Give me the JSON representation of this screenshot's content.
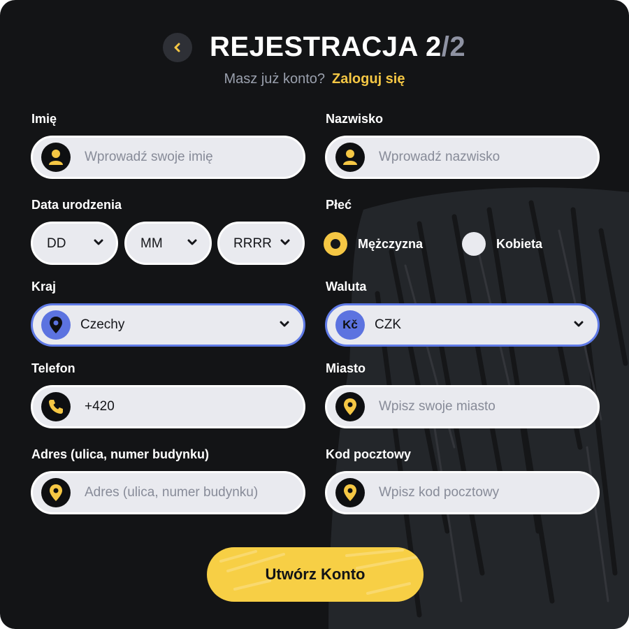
{
  "header": {
    "title_main": "REJESTRACJA 2",
    "title_sep": "/",
    "title_total": "2",
    "subtitle_text": "Masz już konto?",
    "login_link": "Zaloguj się"
  },
  "form": {
    "first_name": {
      "label": "Imię",
      "placeholder": "Wprowadź swoje imię"
    },
    "last_name": {
      "label": "Nazwisko",
      "placeholder": "Wprowadź nazwisko"
    },
    "birth_date": {
      "label": "Data urodzenia",
      "day": "DD",
      "month": "MM",
      "year": "RRRR"
    },
    "gender": {
      "label": "Płeć",
      "options": [
        "Mężczyzna",
        "Kobieta"
      ],
      "selected": "Mężczyzna"
    },
    "country": {
      "label": "Kraj",
      "value": "Czechy"
    },
    "currency": {
      "label": "Waluta",
      "value": "CZK",
      "icon_text": "Kč"
    },
    "phone": {
      "label": "Telefon",
      "value": "+420"
    },
    "city": {
      "label": "Miasto",
      "placeholder": "Wpisz swoje miasto"
    },
    "address": {
      "label": "Adres (ulica, numer budynku)",
      "placeholder": "Adres (ulica, numer budynku)"
    },
    "postal_code": {
      "label": "Kod pocztowy",
      "placeholder": "Wpisz kod pocztowy"
    }
  },
  "submit_label": "Utwórz Konto",
  "colors": {
    "background": "#131416",
    "accent_yellow": "#f5c744",
    "selected_border": "#5f7ae6",
    "field_bg": "#e9eaef"
  },
  "icons": [
    "back-chevron-icon",
    "user-icon",
    "chevron-down-icon",
    "location-pin-icon",
    "currency-icon",
    "phone-icon"
  ]
}
